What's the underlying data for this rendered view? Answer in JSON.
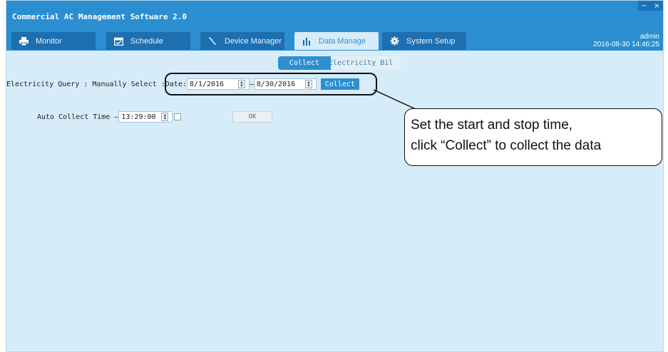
{
  "window": {
    "title": "Commercial AC Management Software 2.0",
    "minimize": "−",
    "close": "×"
  },
  "tabs": [
    {
      "label": "Monitor",
      "icon": "printer-icon"
    },
    {
      "label": "Schedule",
      "icon": "calendar-icon"
    },
    {
      "label": "Device Manager",
      "icon": "wrench-icon"
    },
    {
      "label": "Data Manage",
      "icon": "bar-chart-icon",
      "active": true
    },
    {
      "label": "System Setup",
      "icon": "gear-icon"
    }
  ],
  "user": {
    "name": "admin",
    "datetime": "2016-08-30 14:46:25"
  },
  "subtabs": {
    "collect": "Collect",
    "bill": "Electricity Bil"
  },
  "query": {
    "label": "Electricity  Query : Manually  Select : ",
    "date_label": "Date: ",
    "start_date": "8/1/2016",
    "separator": " – ",
    "end_date": "8/30/2016",
    "collect_button": "Collect"
  },
  "auto": {
    "label": "Auto Collect   Time – ",
    "time": "13:29:00",
    "ok_button": "OK"
  },
  "callout": {
    "line1": "Set the start and stop time,",
    "line2": "click “Collect” to collect the data"
  },
  "colors": {
    "titlebar": "#2a8ed1",
    "tab_inactive": "#1d6fb0",
    "content_bg": "#d6ecf8",
    "accent": "#2e8fd0"
  }
}
